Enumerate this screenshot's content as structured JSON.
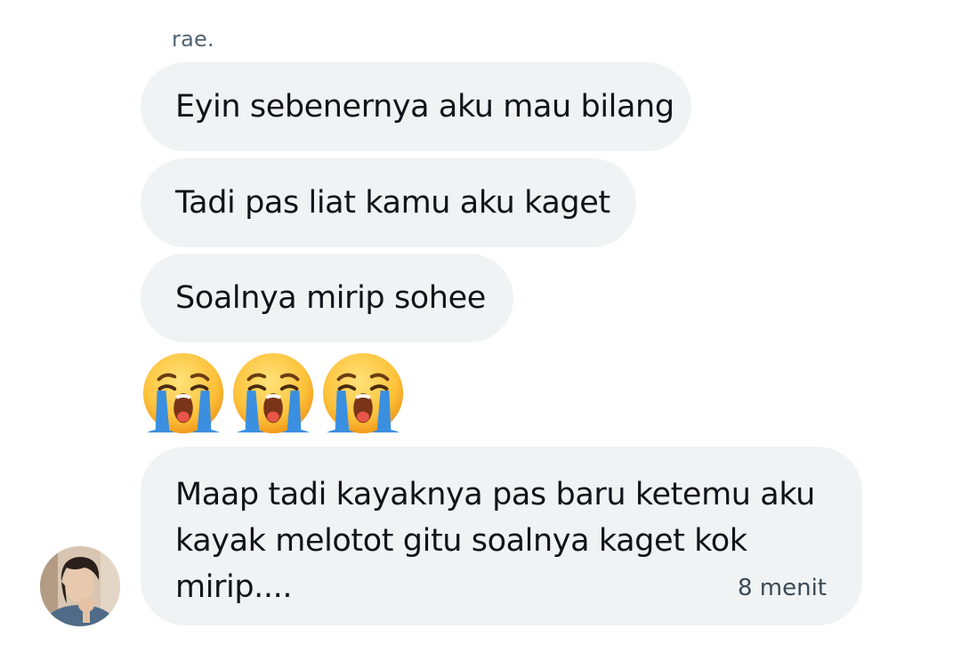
{
  "conversation": {
    "sender_name": "rae.",
    "messages": [
      {
        "text": "Eyin sebenernya aku mau bilang"
      },
      {
        "text": "Tadi pas liat kamu aku kaget"
      },
      {
        "text": "Soalnya mirip sohee"
      },
      {
        "emoji": [
          "loudly-crying-face",
          "loudly-crying-face",
          "loudly-crying-face"
        ]
      },
      {
        "lines": [
          "Maap tadi kayaknya pas baru ketemu aku",
          "kayak melotot gitu soalnya kaget kok",
          "mirip...."
        ],
        "timestamp": "8 menit"
      }
    ]
  },
  "colors": {
    "bubble_bg": "#eff3f4",
    "sender_text": "#536471",
    "message_text": "#0f1419"
  }
}
